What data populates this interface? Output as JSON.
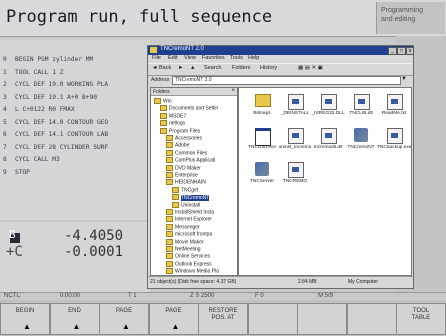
{
  "header": {
    "title": "Program run, full sequence",
    "mode_lines": [
      "Programming",
      "and editing"
    ]
  },
  "program": {
    "lines": [
      {
        "n": "0",
        "text": "BEGIN PGM zylinder MM"
      },
      {
        "n": "1",
        "text": "TOOL CALL 1 Z"
      },
      {
        "n": "2",
        "text": "CYCL DEF 19.0 WORKING PLA"
      },
      {
        "n": "3",
        "text": "CYCL DEF 19.1 A+0 B+90"
      },
      {
        "n": "4",
        "text": "L  C+0122 R0 FMAX"
      },
      {
        "n": "5",
        "text": "CYCL DEF 14.0 CONTOUR GEO"
      },
      {
        "n": "6",
        "text": "CYCL DEF 14.1 CONTOUR LAB"
      },
      {
        "n": "7",
        "text": "CYCL DEF 28 CYLINDER SURF"
      },
      {
        "n": "8",
        "text": "CYCL CALL M3"
      },
      {
        "n": "9",
        "text": "STOP"
      }
    ]
  },
  "position": {
    "rows": [
      {
        "axis": "B",
        "value": "-4.4050"
      },
      {
        "axis": "+C",
        "value": "-0.0001"
      }
    ]
  },
  "explorer": {
    "title": "TNCremoNT 2.0",
    "menus": [
      "File",
      "Edit",
      "View",
      "Favorites",
      "Tools",
      "Help"
    ],
    "toolbar": [
      "Back",
      "Search",
      "Folders",
      "History"
    ],
    "address_label": "Address",
    "address_value": "TNCremoNT 2.0",
    "tree_header": "Folders",
    "tree": [
      {
        "depth": 0,
        "label": "Win"
      },
      {
        "depth": 1,
        "label": "Documents and Settin"
      },
      {
        "depth": 1,
        "label": "MSDE7"
      },
      {
        "depth": 1,
        "label": "netlogs"
      },
      {
        "depth": 1,
        "label": "Program Files"
      },
      {
        "depth": 2,
        "label": "Accessories"
      },
      {
        "depth": 2,
        "label": "Adobe"
      },
      {
        "depth": 2,
        "label": "Common Files"
      },
      {
        "depth": 2,
        "label": "ComPlus Applicati"
      },
      {
        "depth": 2,
        "label": "DVD Maker"
      },
      {
        "depth": 2,
        "label": "Enterprise"
      },
      {
        "depth": 2,
        "label": "HEIDENHAIN"
      },
      {
        "depth": 3,
        "label": "TNCget"
      },
      {
        "depth": 3,
        "label": "TNCremoNT"
      },
      {
        "depth": 3,
        "label": "Uninstall"
      },
      {
        "depth": 2,
        "label": "InstallShield Insta"
      },
      {
        "depth": 2,
        "label": "Internet Explorer"
      },
      {
        "depth": 2,
        "label": "Messenger"
      },
      {
        "depth": 2,
        "label": "microsoft frontpa"
      },
      {
        "depth": 2,
        "label": "Movie Maker"
      },
      {
        "depth": 2,
        "label": "NetMeeting"
      },
      {
        "depth": 2,
        "label": "Online Services"
      },
      {
        "depth": 2,
        "label": "Outlook Express"
      },
      {
        "depth": 2,
        "label": "Windows Media Pla"
      }
    ],
    "files": [
      {
        "icon": "folder",
        "label": "Bitmaps"
      },
      {
        "icon": "doc",
        "label": "_DEINSTALL"
      },
      {
        "icon": "doc",
        "label": "_ISREG32.DLL"
      },
      {
        "icon": "doc",
        "label": "TNCLIB.dll"
      },
      {
        "icon": "doc",
        "label": "ReadMe.txt"
      },
      {
        "icon": "window",
        "label": "TNCcmd.exe"
      },
      {
        "icon": "doc",
        "label": "uninst_tncremo"
      },
      {
        "icon": "doc",
        "label": "tncremodll.dll"
      },
      {
        "icon": "app",
        "label": "TNCremoNT"
      },
      {
        "icon": "doc",
        "label": "TNCbackup.exe"
      },
      {
        "icon": "app",
        "label": "TNCServer"
      },
      {
        "icon": "doc",
        "label": "TNCREMO"
      }
    ],
    "status_left": "21 object(s) (Disk free space: 4.37 GB)",
    "status_mid": "2.84 MB",
    "status_right": "My Computer"
  },
  "status_bar": [
    "NCTL:",
    "0:00:00",
    "T 1",
    "Z S 2500",
    "F 0",
    "M 5/9"
  ],
  "softkeys": [
    {
      "l1": "BEGIN",
      "l2": ""
    },
    {
      "l1": "END",
      "l2": ""
    },
    {
      "l1": "PAGE",
      "l2": ""
    },
    {
      "l1": "PAGE",
      "l2": ""
    },
    {
      "l1": "RESTORE",
      "l2": "POS. AT"
    },
    {
      "l1": "",
      "l2": ""
    },
    {
      "l1": "",
      "l2": ""
    },
    {
      "l1": "",
      "l2": ""
    },
    {
      "l1": "TOOL",
      "l2": "TABLE"
    }
  ]
}
